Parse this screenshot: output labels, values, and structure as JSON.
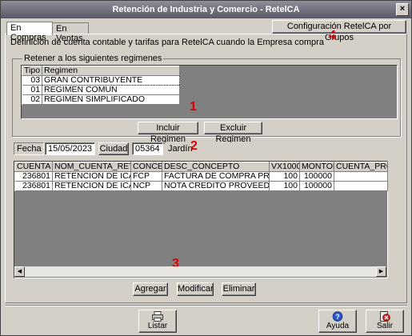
{
  "window": {
    "title": "Retención de Industria y Comercio - RetelCA",
    "close_label": "×"
  },
  "tabs": [
    {
      "label": "En Compras"
    },
    {
      "label": "En Ventas"
    }
  ],
  "config_button": "Configuración RetelCA por Grupos",
  "description": "Definición de cuenta contable y tarifas para RetelCA cuando la Empresa compra",
  "regimes": {
    "legend": "Retener a los siguientes regimenes",
    "headers": {
      "tipo": "Tipo",
      "regimen": "Regimen"
    },
    "rows": [
      {
        "tipo": "03",
        "regimen": "GRAN CONTRIBUYENTE"
      },
      {
        "tipo": "01",
        "regimen": "REGIMEN COMUN"
      },
      {
        "tipo": "02",
        "regimen": "REGIMEN SIMPLIFICADO"
      }
    ],
    "include_button": "Incluir Regimen",
    "exclude_button": "Excluir Regimen"
  },
  "filters": {
    "fecha_label": "Fecha",
    "fecha_value": "15/05/2023",
    "ciudad_button": "Ciudad",
    "ciudad_code": "05364",
    "ciudad_name": "Jardín"
  },
  "concepts": {
    "headers": [
      "CUENTA",
      "NOM_CUENTA_RET",
      "CONCEP",
      "DESC_CONCEPTO",
      "VX1000",
      "MONTOM",
      "CUENTA_PRO"
    ],
    "rows": [
      [
        "236801",
        "RETENCION DE ICA",
        "FCP",
        "FACTURA DE COMPRA PROVEE",
        "100",
        "100000",
        ""
      ],
      [
        "236801",
        "RETENCION DE ICA",
        "NCP",
        "NOTA CREDITO PROVEEDORES",
        "100",
        "100000",
        ""
      ]
    ],
    "add_button": "Agregar",
    "modify_button": "Modificar",
    "delete_button": "Eliminar"
  },
  "markers": {
    "m1": "1",
    "m2": "2",
    "m3": "3",
    "m4": "4"
  },
  "footer": {
    "list_button": "Listar",
    "help_button": "Ayuda",
    "exit_button": "Salir"
  },
  "colors": {
    "title_bar": "#6f6f7d",
    "face": "#d4d0c8",
    "grid_empty": "#808080",
    "marker": "#e00000"
  }
}
